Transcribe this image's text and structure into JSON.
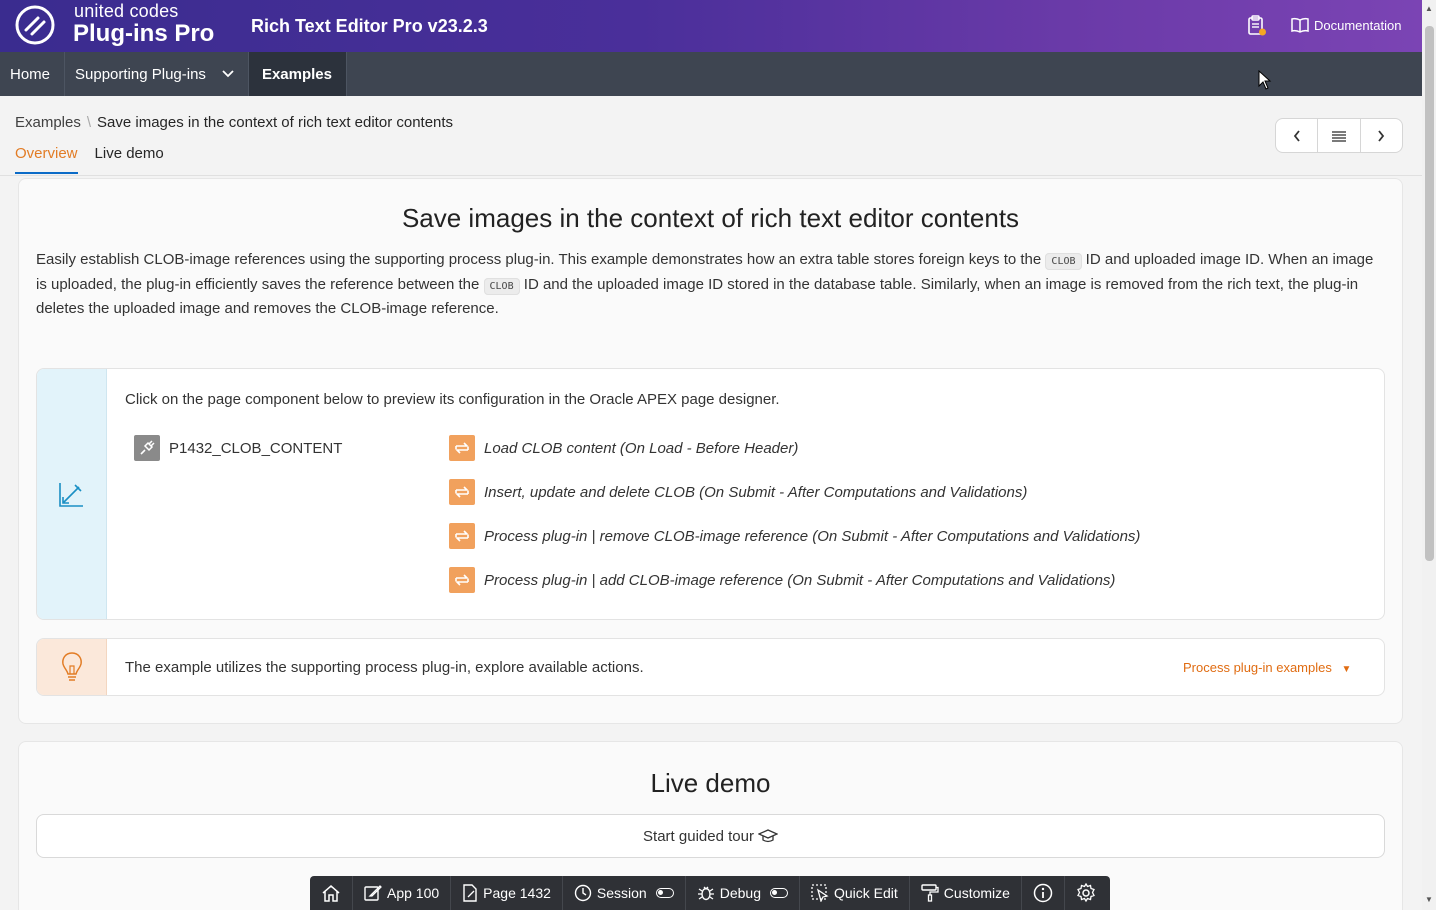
{
  "header": {
    "brand_line1": "united codes",
    "brand_line2": "Plug-ins Pro",
    "app_title": "Rich Text Editor Pro v23.2.3",
    "documentation_label": "Documentation",
    "colors": {
      "gradient_start": "#3a2c8f",
      "gradient_end": "#7b44b4"
    }
  },
  "nav": {
    "items": [
      {
        "label": "Home"
      },
      {
        "label": "Supporting Plug-ins",
        "has_dropdown": true
      },
      {
        "label": "Examples",
        "active": true
      }
    ]
  },
  "breadcrumb": {
    "parent": "Examples",
    "current": "Save images in the context of rich text editor contents"
  },
  "tabs": [
    {
      "label": "Overview",
      "active": true
    },
    {
      "label": "Live demo"
    }
  ],
  "main": {
    "title": "Save images in the context of rich text editor contents",
    "desc_part1": "Easily establish CLOB-image references using the supporting process plug-in. This example demonstrates how an extra table stores foreign keys to the ",
    "desc_code1": "CLOB",
    "desc_part2": " ID and uploaded image ID. When an image is uploaded, the plug-in efficiently saves the reference between the ",
    "desc_code2": "CLOB",
    "desc_part3": " ID and the uploaded image ID stored in the database table. Similarly, when an image is removed from the rich text, the plug-in deletes the uploaded image and removes the CLOB-image reference.",
    "info_hint": "Click on the page component below to preview its configuration in the Oracle APEX page designer.",
    "page_item": "P1432_CLOB_CONTENT",
    "processes": [
      "Load CLOB content (On Load - Before Header)",
      "Insert, update and delete CLOB (On Submit - After Computations and Validations)",
      "Process plug-in | remove CLOB-image reference (On Submit - After Computations and Validations)",
      "Process plug-in | add CLOB-image reference (On Submit - After Computations and Validations)"
    ],
    "tip_text": "The example utilizes the supporting process plug-in, explore available actions.",
    "tip_link": "Process plug-in examples",
    "accent_color": "#e27c25"
  },
  "live_demo": {
    "title": "Live demo",
    "tour_button": "Start guided tour"
  },
  "devbar": {
    "app": "App 100",
    "page": "Page 1432",
    "session": "Session",
    "debug": "Debug",
    "quick_edit": "Quick Edit",
    "customize": "Customize"
  }
}
